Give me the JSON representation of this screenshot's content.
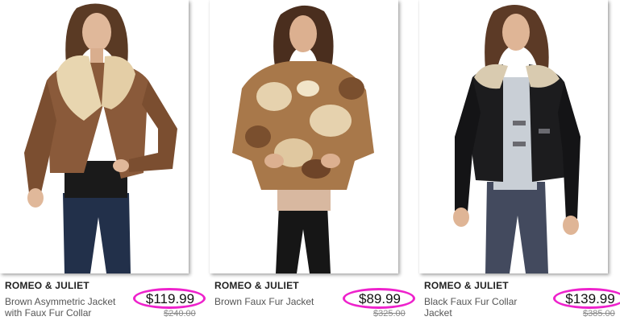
{
  "products": [
    {
      "brand": "ROMEO & JULIET",
      "name": "Brown Asymmetric Jacket with Faux Fur Collar",
      "price": "$119.99",
      "was_price": "$240.00",
      "colors": {
        "jacket": "#8a5a3a",
        "fur": "#e8d6b0",
        "top": "#1a1a1a",
        "pants": "#22304a"
      }
    },
    {
      "brand": "ROMEO & JULIET",
      "name": "Brown Faux Fur Jacket",
      "price": "$89.99",
      "was_price": "$325.00",
      "colors": {
        "jacket": "#a8784a",
        "fur": "#e6d2ae",
        "top": "#d8b8a0",
        "pants": "#161616"
      }
    },
    {
      "brand": "ROMEO & JULIET",
      "name": "Black Faux Fur Collar Jacket",
      "price": "$139.99",
      "was_price": "$385.00",
      "colors": {
        "jacket": "#1c1c1e",
        "fur": "#d9cbb0",
        "top": "#c9cfd6",
        "pants": "#434a5e"
      }
    }
  ],
  "highlight_color": "#ee22cc"
}
